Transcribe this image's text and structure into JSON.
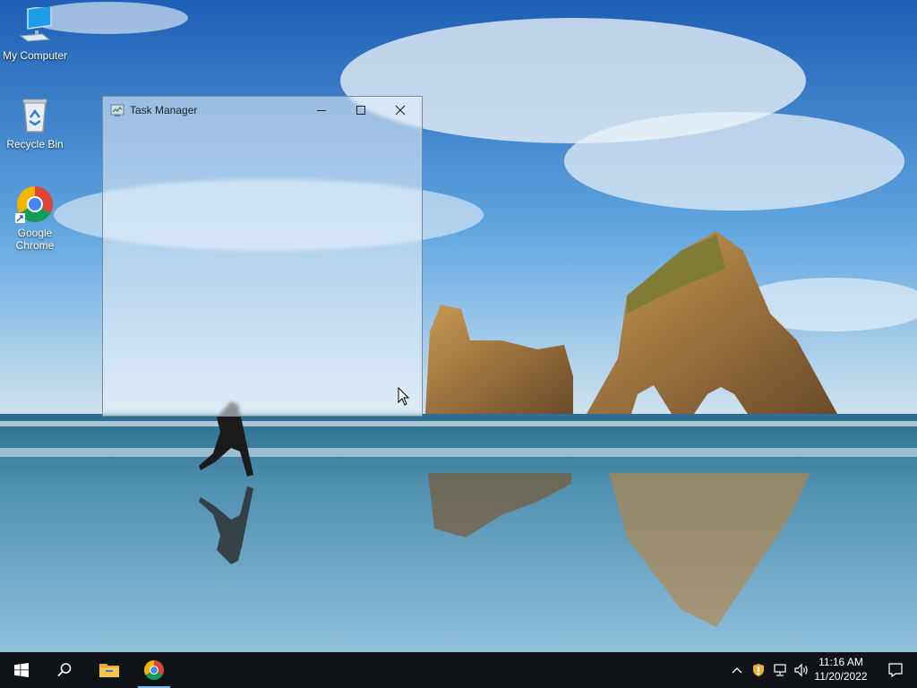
{
  "desktop": {
    "icons": [
      {
        "label": "My Computer",
        "icon": "computer-icon"
      },
      {
        "label": "Recycle Bin",
        "icon": "recycle-bin-icon"
      },
      {
        "label": "Google Chrome",
        "icon": "chrome-icon"
      }
    ]
  },
  "window": {
    "title": "Task Manager",
    "icon": "task-manager-icon",
    "controls": [
      "minimize-icon",
      "maximize-icon",
      "close-icon"
    ]
  },
  "taskbar": {
    "buttons": [
      "windows-start-icon",
      "search-icon",
      "file-explorer-icon",
      "chrome-icon"
    ],
    "tray": [
      "chevron-up-icon",
      "security-shield-icon",
      "network-icon",
      "volume-icon"
    ],
    "clock": {
      "time": "11:16 AM",
      "date": "11/20/2022"
    },
    "notification_icon": "notification-icon"
  },
  "colors": {
    "taskbar": "#101418",
    "accent": "#76b9ed"
  }
}
